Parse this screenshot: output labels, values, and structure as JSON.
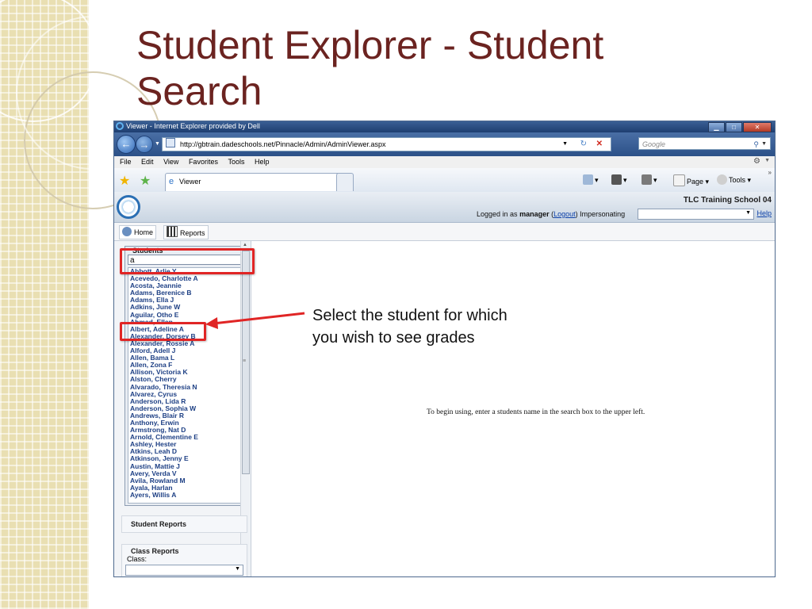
{
  "slide": {
    "title": "Student Explorer - Student Search",
    "annotation": "Select the student for which you wish to see grades"
  },
  "window": {
    "title": "Viewer - Internet Explorer provided by Dell",
    "controls": {
      "minimize": "▁",
      "maximize": "□",
      "close": "✕"
    }
  },
  "browser": {
    "url": "http://gbtrain.dadeschools.net/Pinnacle/Admin/AdminViewer.aspx",
    "search_placeholder": "Google",
    "menu": [
      "File",
      "Edit",
      "View",
      "Favorites",
      "Tools",
      "Help"
    ],
    "tab_label": "Viewer",
    "commands": {
      "page": "Page",
      "tools": "Tools"
    }
  },
  "app": {
    "school": "TLC Training School 04",
    "logged_prefix": "Logged in as",
    "user": "manager",
    "logout": "Logout",
    "impersonating": "Impersonating",
    "help": "Help",
    "toolbar": {
      "home": "Home",
      "reports": "Reports"
    },
    "students_label": "Students",
    "search_value": "a",
    "students": [
      "Abbott, Arlie Y",
      "Acevedo, Charlotte A",
      "Acosta, Jeannie",
      "Adams, Berenice B",
      "Adams, Ella J",
      "Adkins, June W",
      "Aguilar, Otho E",
      "Ahmed, Ellen",
      "Albert, Adeline A",
      "Alexander, Dorsey B",
      "Alexander, Rossie A",
      "Alford, Adell J",
      "Allen, Bama L",
      "Allen, Zona F",
      "Allison, Victoria K",
      "Alston, Cherry",
      "Alvarado, Theresia N",
      "Alvarez, Cyrus",
      "Anderson, Lida R",
      "Anderson, Sophia W",
      "Andrews, Blair R",
      "Anthony, Erwin",
      "Armstrong, Nat D",
      "Arnold, Clementine E",
      "Ashley, Hester",
      "Atkins, Leah D",
      "Atkinson, Jenny E",
      "Austin, Mattie J",
      "Avery, Verda V",
      "Avila, Rowland M",
      "Ayala, Harlan",
      "Ayers, Willis A"
    ],
    "student_reports": "Student Reports",
    "class_reports": "Class Reports",
    "class_label": "Class:",
    "instruction": "To begin using, enter a students name in the search box to the upper left."
  },
  "colors": {
    "title": "#6b2320",
    "callout": "#e02525",
    "link": "#0b3fa8",
    "student_name": "#1d3f84"
  },
  "icons": {
    "back": "back-arrow-icon",
    "forward": "forward-arrow-icon",
    "refresh": "refresh-icon",
    "stop": "stop-icon",
    "search": "magnifier-icon",
    "home": "home-icon",
    "rss": "rss-icon",
    "print": "printer-icon",
    "page": "page-icon",
    "tools": "gear-icon",
    "favorites": "star-icon"
  }
}
